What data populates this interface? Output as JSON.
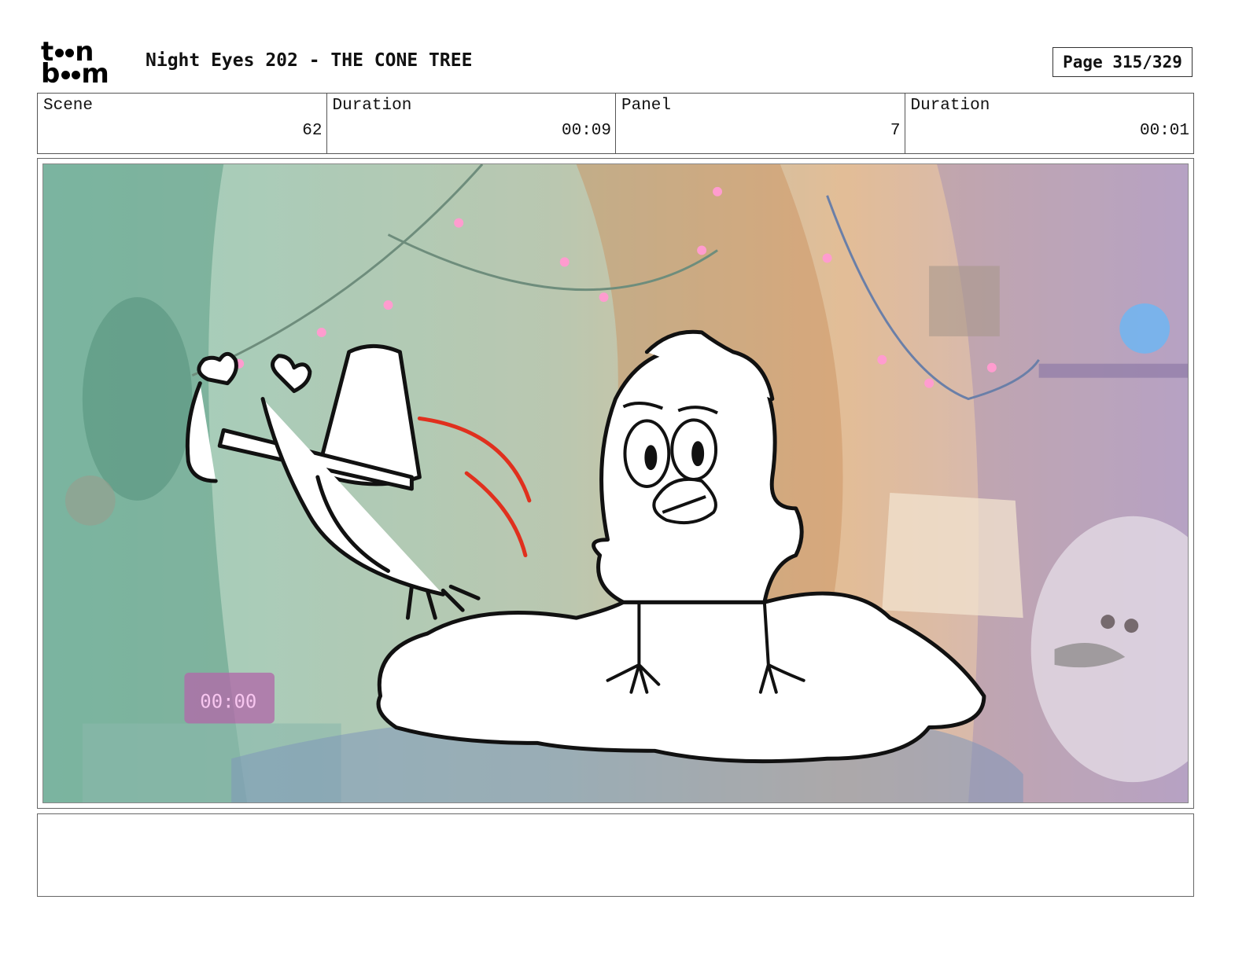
{
  "header": {
    "logo_top": "toon",
    "logo_bottom": "boom",
    "project_title": "Night Eyes 202 - THE CONE TREE",
    "page_label": "Page 315/329"
  },
  "info": {
    "scene_label": "Scene",
    "scene_value": "62",
    "scene_duration_label": "Duration",
    "scene_duration_value": "00:09",
    "panel_label": "Panel",
    "panel_value": "7",
    "panel_duration_label": "Duration",
    "panel_duration_value": "00:01"
  },
  "panel": {
    "clock_text": "00:00",
    "colors": {
      "bg_green": "#6fb3a0",
      "bg_orange": "#d79a64",
      "sketch_line": "#111111",
      "motion_line": "#e0301e"
    }
  },
  "notes": {
    "text": ""
  }
}
